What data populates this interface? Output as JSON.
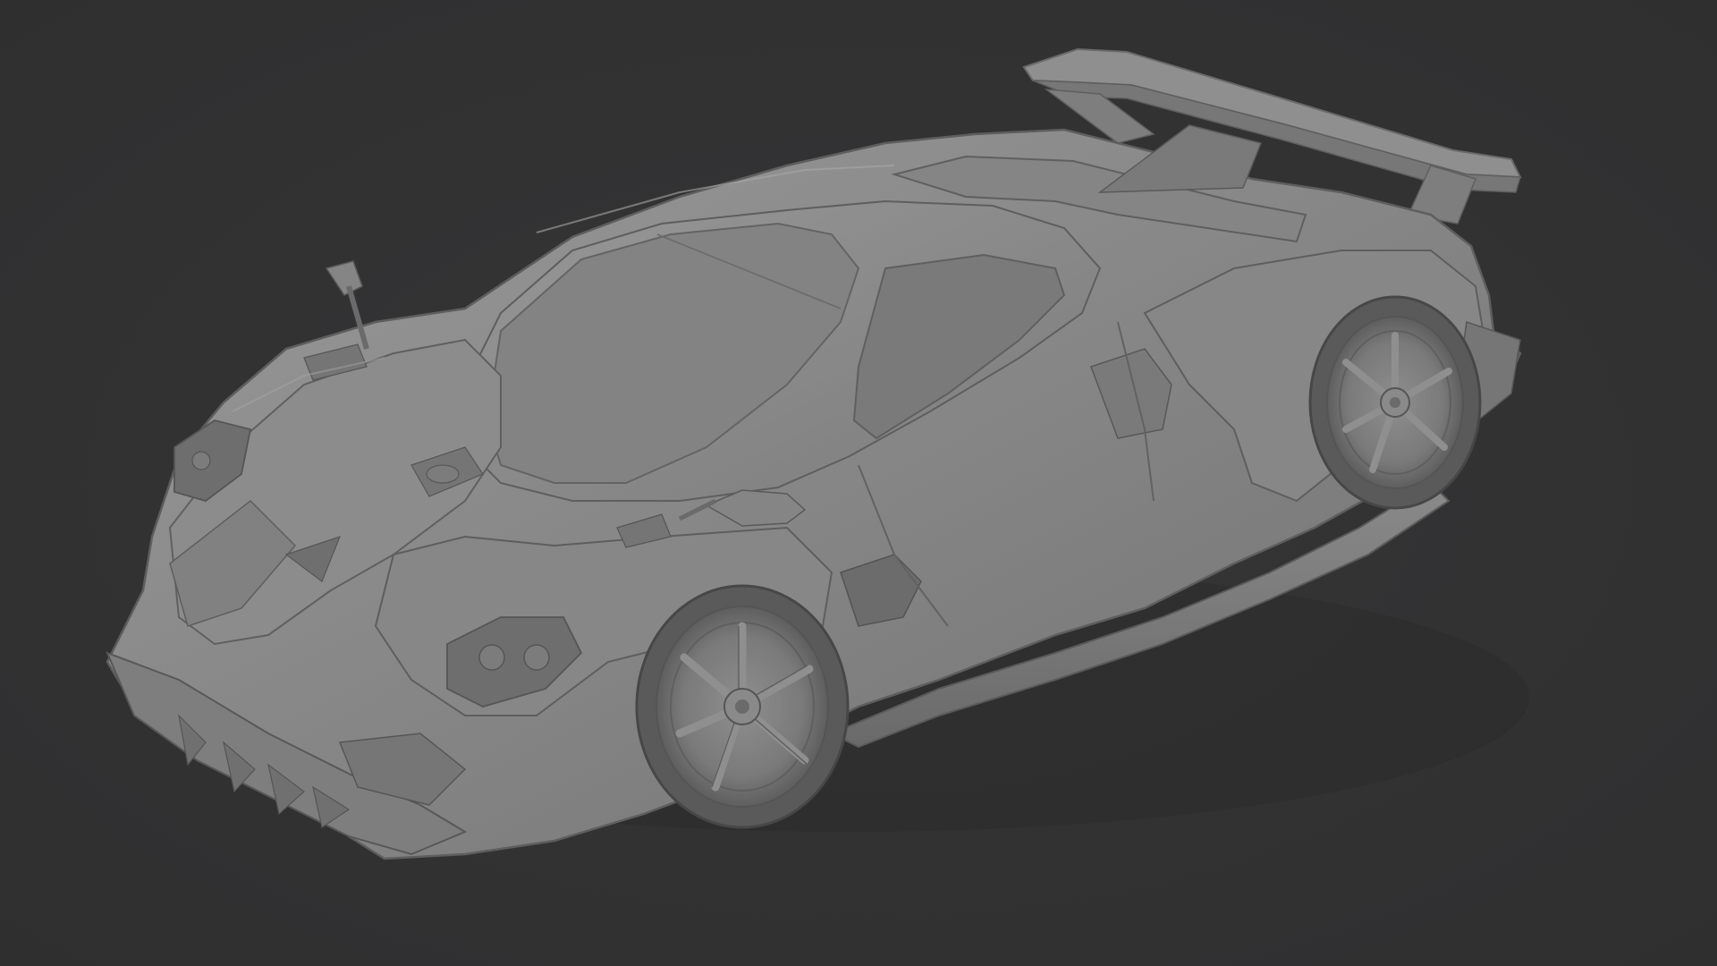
{
  "viewport": {
    "background_color": "#323233",
    "model_color": "#8a8a8a",
    "subject": "car-clay-render"
  }
}
